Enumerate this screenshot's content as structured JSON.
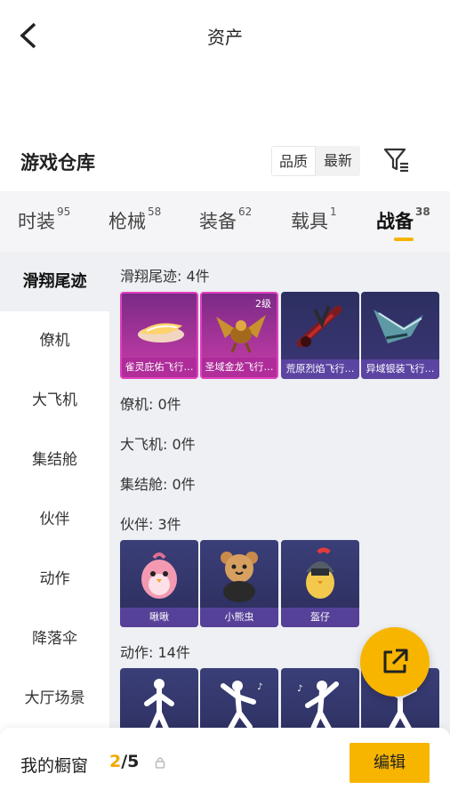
{
  "header": {
    "title": "资产"
  },
  "warehouse": {
    "title": "游戏仓库",
    "sort_options": [
      "品质",
      "最新"
    ]
  },
  "tabs": [
    {
      "label": "时装",
      "count": "95"
    },
    {
      "label": "枪械",
      "count": "58"
    },
    {
      "label": "装备",
      "count": "62"
    },
    {
      "label": "载具",
      "count": "1"
    },
    {
      "label": "战备",
      "count": "38"
    }
  ],
  "sidebar": {
    "items": [
      "滑翔尾迹",
      "僚机",
      "大飞机",
      "集结舱",
      "伙伴",
      "动作",
      "降落伞",
      "大厅场景"
    ]
  },
  "groups": {
    "trail": {
      "label": "滑翔尾迹: 4件",
      "items": [
        {
          "name": "雀灵庇佑飞行…",
          "level": ""
        },
        {
          "name": "圣域金龙飞行…",
          "level": "2级"
        },
        {
          "name": "荒原烈焰飞行…",
          "level": ""
        },
        {
          "name": "异域银装飞行…",
          "level": ""
        }
      ]
    },
    "wingman": {
      "label": "僚机: 0件"
    },
    "plane": {
      "label": "大飞机: 0件"
    },
    "pod": {
      "label": "集结舱: 0件"
    },
    "partner": {
      "label": "伙伴: 3件",
      "items": [
        {
          "name": "啾啾"
        },
        {
          "name": "小熊虫"
        },
        {
          "name": "盔仔"
        }
      ]
    },
    "emote": {
      "label": "动作: 14件"
    }
  },
  "bottom": {
    "showcase_label": "我的橱窗",
    "current": "2",
    "total": "/5",
    "edit_label": "编辑"
  },
  "colors": {
    "accent": "#f7b500",
    "pink_frame": "#e03fbd"
  }
}
